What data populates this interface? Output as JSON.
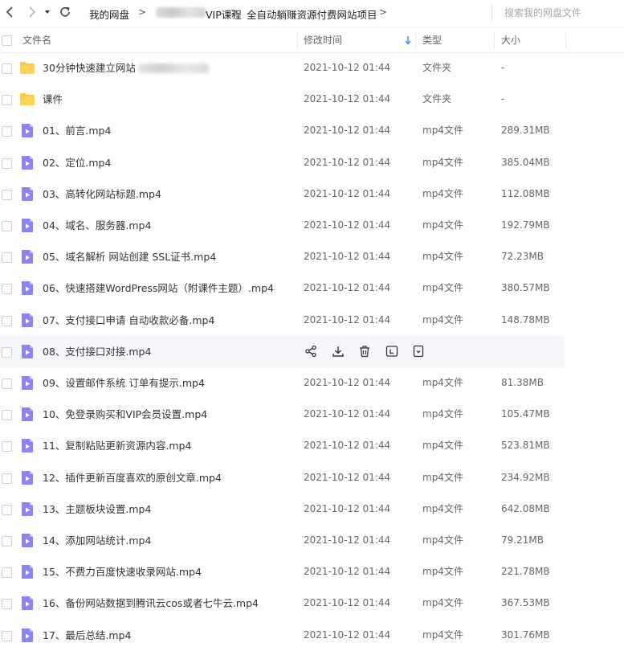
{
  "breadcrumb": {
    "items": [
      "我的网盘",
      "VIP课程",
      "全自动躺赚资源付费网站项目"
    ],
    "separator": ">"
  },
  "search": {
    "placeholder": "搜索我的网盘文件"
  },
  "columns": {
    "name": "文件名",
    "modified": "修改时间",
    "type": "类型",
    "size": "大小"
  },
  "icons": {
    "back": "chevron-left-icon",
    "forward": "chevron-right-icon",
    "history": "caret-down-icon",
    "refresh": "refresh-icon",
    "sort": "sort-down-arrow-icon",
    "folder": "folder-icon",
    "video": "video-file-icon",
    "actions": [
      "share-icon",
      "download-icon",
      "delete-icon",
      "rename-icon",
      "more-icon"
    ]
  },
  "colors": {
    "folder": "#ffc93d",
    "video": "#8b84f2",
    "accent": "#3a8ef6",
    "hover": "#f5f7fa"
  },
  "hover_row_index": 9,
  "files": [
    {
      "name": "30分钟快速建立网站",
      "modified": "2021-10-12 01:44",
      "type": "文件夹",
      "size": "-",
      "kind": "folder"
    },
    {
      "name": "课件",
      "modified": "2021-10-12 01:44",
      "type": "文件夹",
      "size": "-",
      "kind": "folder"
    },
    {
      "name": "01、前言.mp4",
      "modified": "2021-10-12 01:44",
      "type": "mp4文件",
      "size": "289.31MB",
      "kind": "video"
    },
    {
      "name": "02、定位.mp4",
      "modified": "2021-10-12 01:44",
      "type": "mp4文件",
      "size": "385.04MB",
      "kind": "video"
    },
    {
      "name": "03、高转化网站标题.mp4",
      "modified": "2021-10-12 01:44",
      "type": "mp4文件",
      "size": "112.08MB",
      "kind": "video"
    },
    {
      "name": "04、域名、服务器.mp4",
      "modified": "2021-10-12 01:44",
      "type": "mp4文件",
      "size": "192.79MB",
      "kind": "video"
    },
    {
      "name": "05、域名解析 网站创建 SSL证书.mp4",
      "modified": "2021-10-12 01:44",
      "type": "mp4文件",
      "size": "72.23MB",
      "kind": "video"
    },
    {
      "name": "06、快速搭建WordPress网站（附课件主题）.mp4",
      "modified": "2021-10-12 01:44",
      "type": "mp4文件",
      "size": "380.57MB",
      "kind": "video"
    },
    {
      "name": "07、支付接口申请 自动收款必备.mp4",
      "modified": "2021-10-12 01:44",
      "type": "mp4文件",
      "size": "148.78MB",
      "kind": "video"
    },
    {
      "name": "08、支付接口对接.mp4",
      "modified": "",
      "type": "",
      "size": "",
      "kind": "video"
    },
    {
      "name": "09、设置邮件系统 订单有提示.mp4",
      "modified": "2021-10-12 01:44",
      "type": "mp4文件",
      "size": "81.38MB",
      "kind": "video"
    },
    {
      "name": "10、免登录购买和VIP会员设置.mp4",
      "modified": "2021-10-12 01:44",
      "type": "mp4文件",
      "size": "105.47MB",
      "kind": "video"
    },
    {
      "name": "11、复制粘贴更新资源内容.mp4",
      "modified": "2021-10-12 01:44",
      "type": "mp4文件",
      "size": "523.81MB",
      "kind": "video"
    },
    {
      "name": "12、插件更新百度喜欢的原创文章.mp4",
      "modified": "2021-10-12 01:44",
      "type": "mp4文件",
      "size": "234.92MB",
      "kind": "video"
    },
    {
      "name": "13、主题板块设置.mp4",
      "modified": "2021-10-12 01:44",
      "type": "mp4文件",
      "size": "642.08MB",
      "kind": "video"
    },
    {
      "name": "14、添加网站统计.mp4",
      "modified": "2021-10-12 01:44",
      "type": "mp4文件",
      "size": "79.21MB",
      "kind": "video"
    },
    {
      "name": "15、不费力百度快速收录网站.mp4",
      "modified": "2021-10-12 01:44",
      "type": "mp4文件",
      "size": "221.78MB",
      "kind": "video"
    },
    {
      "name": "16、备份网站数据到腾讯云cos或者七牛云.mp4",
      "modified": "2021-10-12 01:44",
      "type": "mp4文件",
      "size": "367.53MB",
      "kind": "video"
    },
    {
      "name": "17、最后总结.mp4",
      "modified": "2021-10-12 01:44",
      "type": "mp4文件",
      "size": "301.76MB",
      "kind": "video"
    }
  ]
}
